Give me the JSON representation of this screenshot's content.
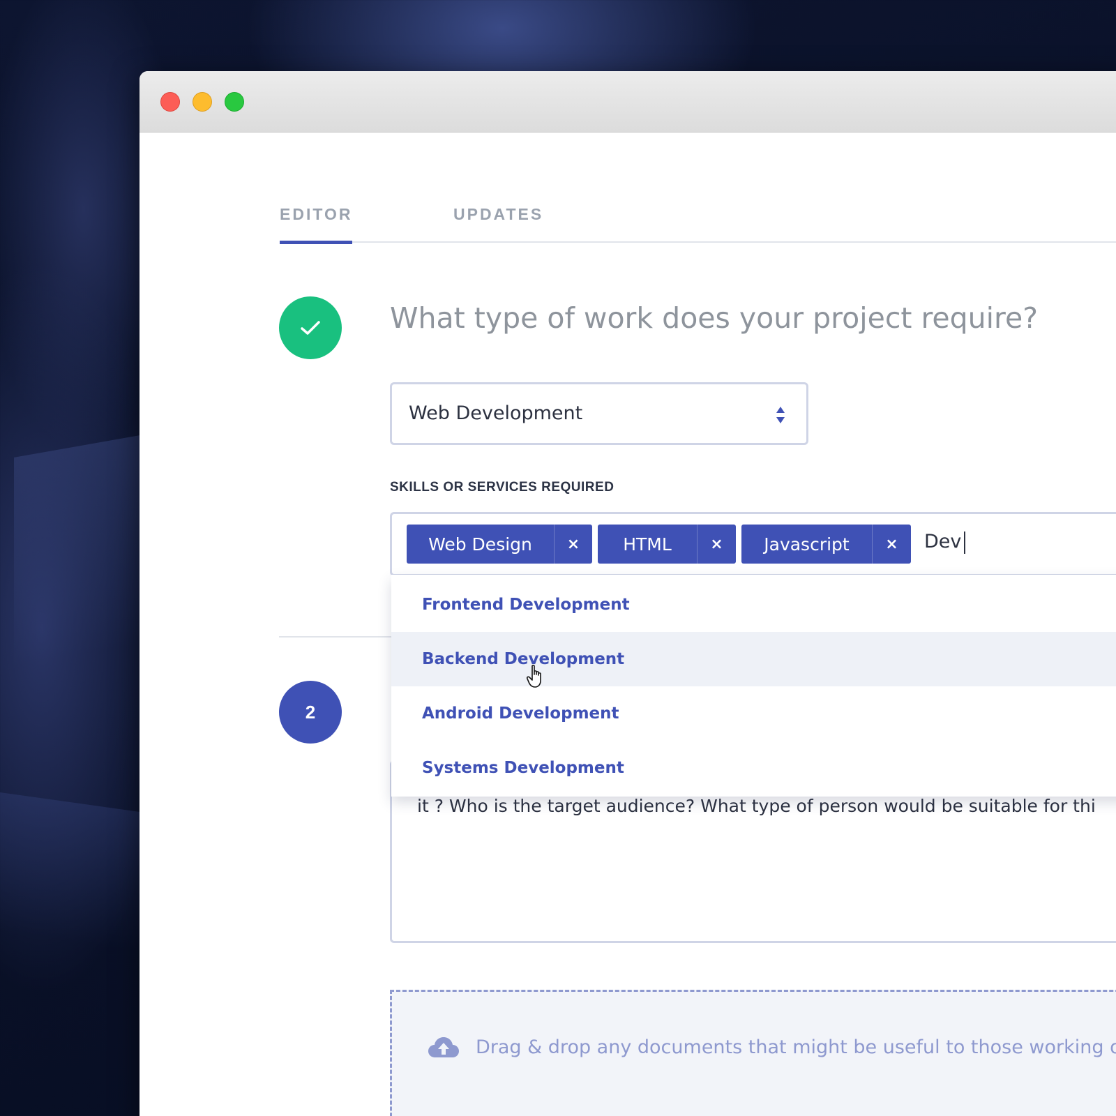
{
  "window": {
    "controls": [
      "close",
      "minimize",
      "maximize"
    ]
  },
  "tabs": [
    {
      "label": "EDITOR",
      "active": true
    },
    {
      "label": "UPDATES",
      "active": false
    }
  ],
  "step1": {
    "status_icon": "check-icon",
    "question": "What type of work does your project require?",
    "category_select": {
      "value": "Web Development"
    },
    "skills_label": "SKILLS OR SERVICES REQUIRED",
    "tags": [
      {
        "label": "Web Design",
        "remove": "×"
      },
      {
        "label": "HTML",
        "remove": "×"
      },
      {
        "label": "Javascript",
        "remove": "×"
      }
    ],
    "typed_value": "Dev"
  },
  "suggestions": [
    {
      "label": "Frontend Development"
    },
    {
      "label": "Backend Development",
      "hovered": true
    },
    {
      "label": "Android Development"
    },
    {
      "label": "Systems Development"
    }
  ],
  "step2": {
    "number": "2",
    "description_text": "it ? Who is the target audience? What type of person would be suitable for thi"
  },
  "dropzone": {
    "icon": "cloud-upload-icon",
    "text": "Drag & drop any documents that might be useful to those working on y"
  },
  "colors": {
    "accent": "#3f51b5",
    "success": "#19c07f",
    "hover_bg": "#eef1f7"
  }
}
